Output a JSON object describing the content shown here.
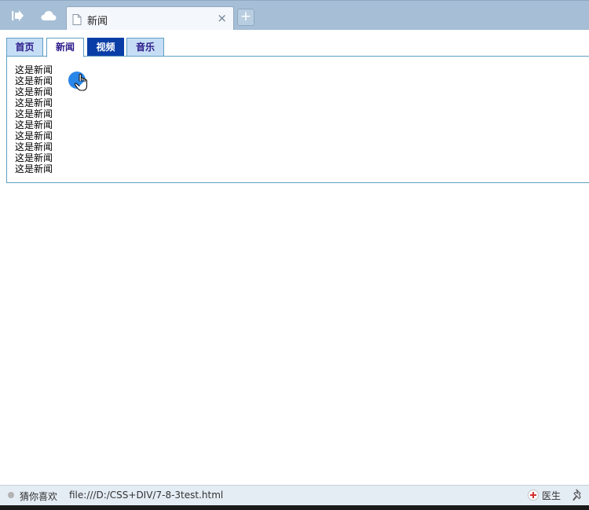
{
  "browser": {
    "active_tab_title": "新闻",
    "close_glyph": "×",
    "new_tab_glyph": "+"
  },
  "nav": {
    "tabs": [
      {
        "label": "首页"
      },
      {
        "label": "新闻"
      },
      {
        "label": "视频"
      },
      {
        "label": "音乐"
      }
    ],
    "active_index": 1,
    "hover_index": 2
  },
  "content": {
    "lines": [
      "这是新闻",
      "这是新闻",
      "这是新闻",
      "这是新闻",
      "这是新闻",
      "这是新闻",
      "这是新闻",
      "这是新闻",
      "这是新闻",
      "这是新闻"
    ]
  },
  "statusbar": {
    "guess_label": "猜你喜欢",
    "url": "file:///D:/CSS+DIV/7-8-3test.html",
    "doctor_label": "医生"
  },
  "icons": {
    "sidebar_toggle": "sidebar-toggle-icon",
    "cloud": "cloud-icon",
    "page": "page-icon",
    "close": "close-icon",
    "doctor": "doctor-icon",
    "pin": "pin-icon",
    "cursor": "hand-cursor-icon"
  },
  "colors": {
    "tabstrip": "#a6bed6",
    "nav_tab_bg": "#c6def5",
    "nav_tab_text": "#2c1a8a",
    "nav_tab_hover_bg": "#0a3ea6",
    "border": "#5f9ec4"
  }
}
